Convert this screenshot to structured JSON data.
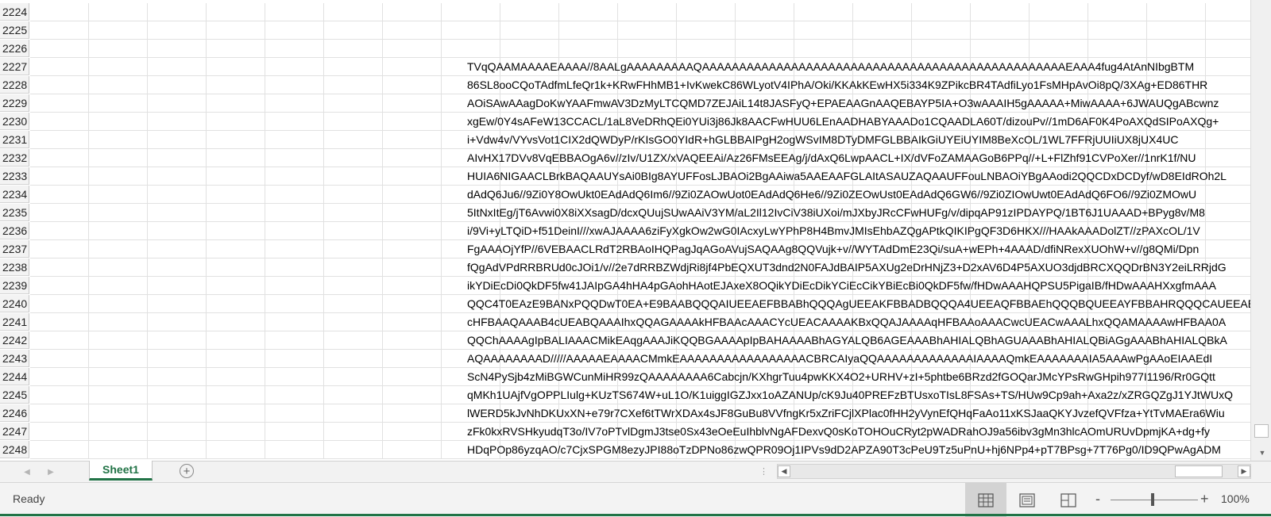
{
  "rows": [
    {
      "num": "2224",
      "text": ""
    },
    {
      "num": "2225",
      "text": ""
    },
    {
      "num": "2226",
      "text": ""
    },
    {
      "num": "2227",
      "text": "TVqQAAMAAAAEAAAA//8AALgAAAAAAAAAQAAAAAAAAAAAAAAAAAAAAAAAAAAAAAAAAAAAAAAAAAAAAAAAAAEAAA4fug4AtAnNIbgBTM"
    },
    {
      "num": "2228",
      "text": "86SL8ooCQoTAdfmLfeQr1k+KRwFHhMB1+IvKwekC86WLyotV4IPhA/Oki/KKAkKEwHX5i334K9ZPikcBR4TAdfiLyo1FsMHpAvOi8pQ/3XAg+ED86THR"
    },
    {
      "num": "2229",
      "text": "AOiSAwAAagDoKwYAAFmwAV3DzMyLTCQMD7ZEJAiL14t8JASFyQ+EPAEAAGnAAQEBAYP5IA+O3wAAAIH5gAAAAA+MiwAAAA+6JWAUQgABcwnz"
    },
    {
      "num": "2230",
      "text": "xgEw/0Y4sAFeW13CCACL/1aL8VeDRhQEi0YUi3j86Jk8AACFwHUU6LEnAADHABYAAADo1CQAADLA60T/dizouPv//1mD6AF0K4PoAXQdSIPoAXQg+"
    },
    {
      "num": "2231",
      "text": "i+Vdw4v/VYvsVot1CIX2dQWDyP/rKIsGO0YIdR+hGLBBAIPgH2ogWSvIM8DTyDMFGLBBAIkGiUYEiUYIM8BeXcOL/1WL7FFRjUUIiUX8jUX4UC"
    },
    {
      "num": "2232",
      "text": "AIvHX17DVv8VqEBBAOgA6v//zIv/U1ZX/xVAQEEAi/Az26FMsEEAg/j/dAxQ6LwpAACL+IX/dVFoZAMAAGoB6PPq//+L+FlZhf91CVPoXer//1nrK1f/NU"
    },
    {
      "num": "2233",
      "text": "HUIA6NIGAACLBrkBAQAAUYsAi0BIg8AYUFFosLJBAOi2BgAAiwa5AAEAAFGLAItASAUZAQAAUFFouLNBAOiYBgAAodi2QQCDxDCDyf/wD8EIdROh2L"
    },
    {
      "num": "2234",
      "text": "dAdQ6Ju6//9Zi0Y8OwUkt0EAdAdQ6Im6//9Zi0ZAOwUot0EAdAdQ6He6//9Zi0ZEOwUst0EAdAdQ6GW6//9Zi0ZIOwUwt0EAdAdQ6FO6//9Zi0ZMOwU"
    },
    {
      "num": "2235",
      "text": "5ItNxItEg/jT6Avwi0X8iXXsagD/dcxQUujSUwAAiV3YM/aL2Il12IvCiV38iUXoi/mJXbyJRcCFwHUFg/v/dipqAP91zIPDAYPQ/1BT6J1UAAAD+BPyg8v/M8"
    },
    {
      "num": "2236",
      "text": "i/9Vi+yLTQiD+f51DeinI///xwAJAAAA6ziFyXgkOw2wG0IAcxyLwYPhP8H4BmvJMIsEhbAZQgAPtkQIKIPgQF3D6HKX///HAAkAAADolZT//zPAXcOL/1V"
    },
    {
      "num": "2237",
      "text": "FgAAAOjYfP//6VEBAACLRdT2RBAoIHQPagJqAGoAVujSAQAAg8QQVujk+v//WYTAdDmE23Qi/suA+wEPh+4AAAD/dfiNRexXUOhW+v//g8QMi/Dpn"
    },
    {
      "num": "2238",
      "text": "fQgAdVPdRRBRUd0cJOi1/v//2e7dRRBZWdjRi8jf4PbEQXUT3dnd2N0FAJdBAIP5AXUg2eDrHNjZ3+D2xAV6D4P5AXUO3djdBRCXQQDrBN3Y2eiLRRjdG"
    },
    {
      "num": "2239",
      "text": "ikYDiEcDi0QkDF5fw41JAIpGA4hHA4pGAohHAotEJAxeX8OQikYDiEcDikYCiEcCikYBiEcBi0QkDF5fw/fHDwAAAHQPSU5PigaIB/fHDwAAAHXxgfmAAA"
    },
    {
      "num": "2240",
      "text": "QQC4T0EAzE9BANxPQQDwT0EA+E9BAABQQQAIUEEAEFBBABhQQQAgUEEAKFBBADBQQQA4UEEAQFBBAEhQQQBQUEEAYFBBAHRQQQCAUEEAEFBBA"
    },
    {
      "num": "2241",
      "text": "cHFBAAQAAAB4cUEABQAAAIhxQQAGAAAAkHFBAAcAAACYcUEACAAAAKBxQQAJAAAAqHFBAAoAAACwcUEACwAAALhxQQAMAAAAwHFBAA0A"
    },
    {
      "num": "2242",
      "text": "QQChAAAAgIpBALIAAACMikEAqgAAAJiKQQBGAAAApIpBAHAAAABhAGYALQB6AGEAAABhAHIALQBhAGUAAABhAHIALQBiAGgAAABhAHIALQBkA"
    },
    {
      "num": "2243",
      "text": "AQAAAAAAAAD/////AAAAAEAAAACMmkEAAAAAAAAAAAAAAAAACBRCAIyaQQAAAAAAAAAAAAAIAAAAQmkEAAAAAAAIA5AAAwPgAAoEIAAEdI"
    },
    {
      "num": "2244",
      "text": "ScN4PySjb4zMiBGWCunMiHR99zQAAAAAAAA6Cabcjn/KXhgrTuu4pwKKX4O2+URHV+zI+5phtbe6BRzd2fGOQarJMcYPsRwGHpih977I1196/Rr0GQtt"
    },
    {
      "num": "2245",
      "text": "qMKh1UAjfVgOPPLIulg+KUzTS674W+uL1O/K1uiggIGZJxx1oAZANUp/cK9Ju40PREFzBTUsxoTIsL8FSAs+TS/HUw9Cp9ah+Axa2z/xZRGQZgJ1YJtWUxQ"
    },
    {
      "num": "2246",
      "text": "lWERD5kJvNhDKUxXN+e79r7CXef6tTWrXDAx4sJF8GuBu8VVfngKr5xZriFCjlXPlac0fHH2yVynEfQHqFaAo11xKSJaaQKYJvzefQVFfza+YtTvMAEra6Wiu"
    },
    {
      "num": "2247",
      "text": "zFk0kxRVSHkyudqT3o/IV7oPTvlDgmJ3tse0Sx43eOeEuIhblvNgAFDexvQ0sKoTOHOuCRyt2pWADRahOJ9a56ibv3gMn3hlcAOmURUvDpmjKA+dg+fy"
    },
    {
      "num": "2248",
      "text": "HDqPOp86yzqAO/c7CjxSPGM8ezyJPI88oTzDPNo86zwQPR09Oj1IPVs9dD2APZA90T3cPeU9Tz5uPnU+hj6NPp4+pT7BPsg+7T76Pg0/ID9QPwAgADM"
    }
  ],
  "sheet_tab": {
    "label": "Sheet1"
  },
  "status": {
    "text": "Ready",
    "zoom": "100%"
  },
  "icons": {
    "add_sheet": "plus-circle-icon",
    "normal_view": "grid-icon",
    "page_layout": "page-layout-icon",
    "page_break": "page-break-icon"
  },
  "colors": {
    "accent": "#217346"
  }
}
